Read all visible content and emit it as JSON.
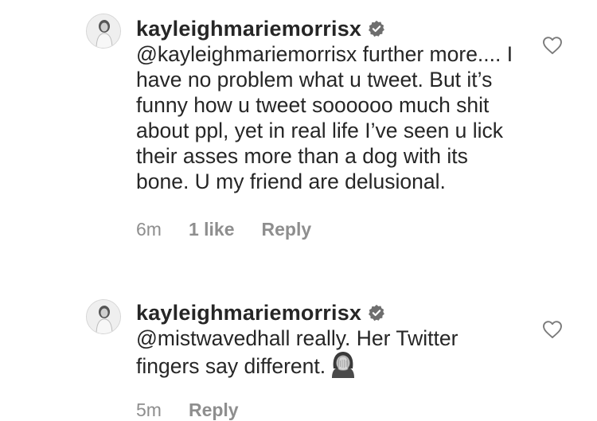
{
  "comments": [
    {
      "username": "kayleighmariemorrisx",
      "text": "@kayleighmariemorrisx further more.... I have no problem what u tweet. But it’s funny how u tweet soooooo much shit about ppl, yet in real life I’ve seen u lick their asses more than a dog with its bone. U my friend are delusional.",
      "time": "6m",
      "likes": "1 like",
      "reply": "Reply"
    },
    {
      "username": "kayleighmariemorrisx",
      "text": "@mistwavedhall really. Her Twitter fingers say different.",
      "time": "5m",
      "reply": "Reply",
      "emoji": "facepalm-emoji"
    }
  ],
  "icons": {
    "verified": "verified-badge-icon",
    "like": "heart-outline-icon"
  },
  "colors": {
    "text": "#262626",
    "meta": "#8e8e8e",
    "badge": "#6e6e6e"
  }
}
